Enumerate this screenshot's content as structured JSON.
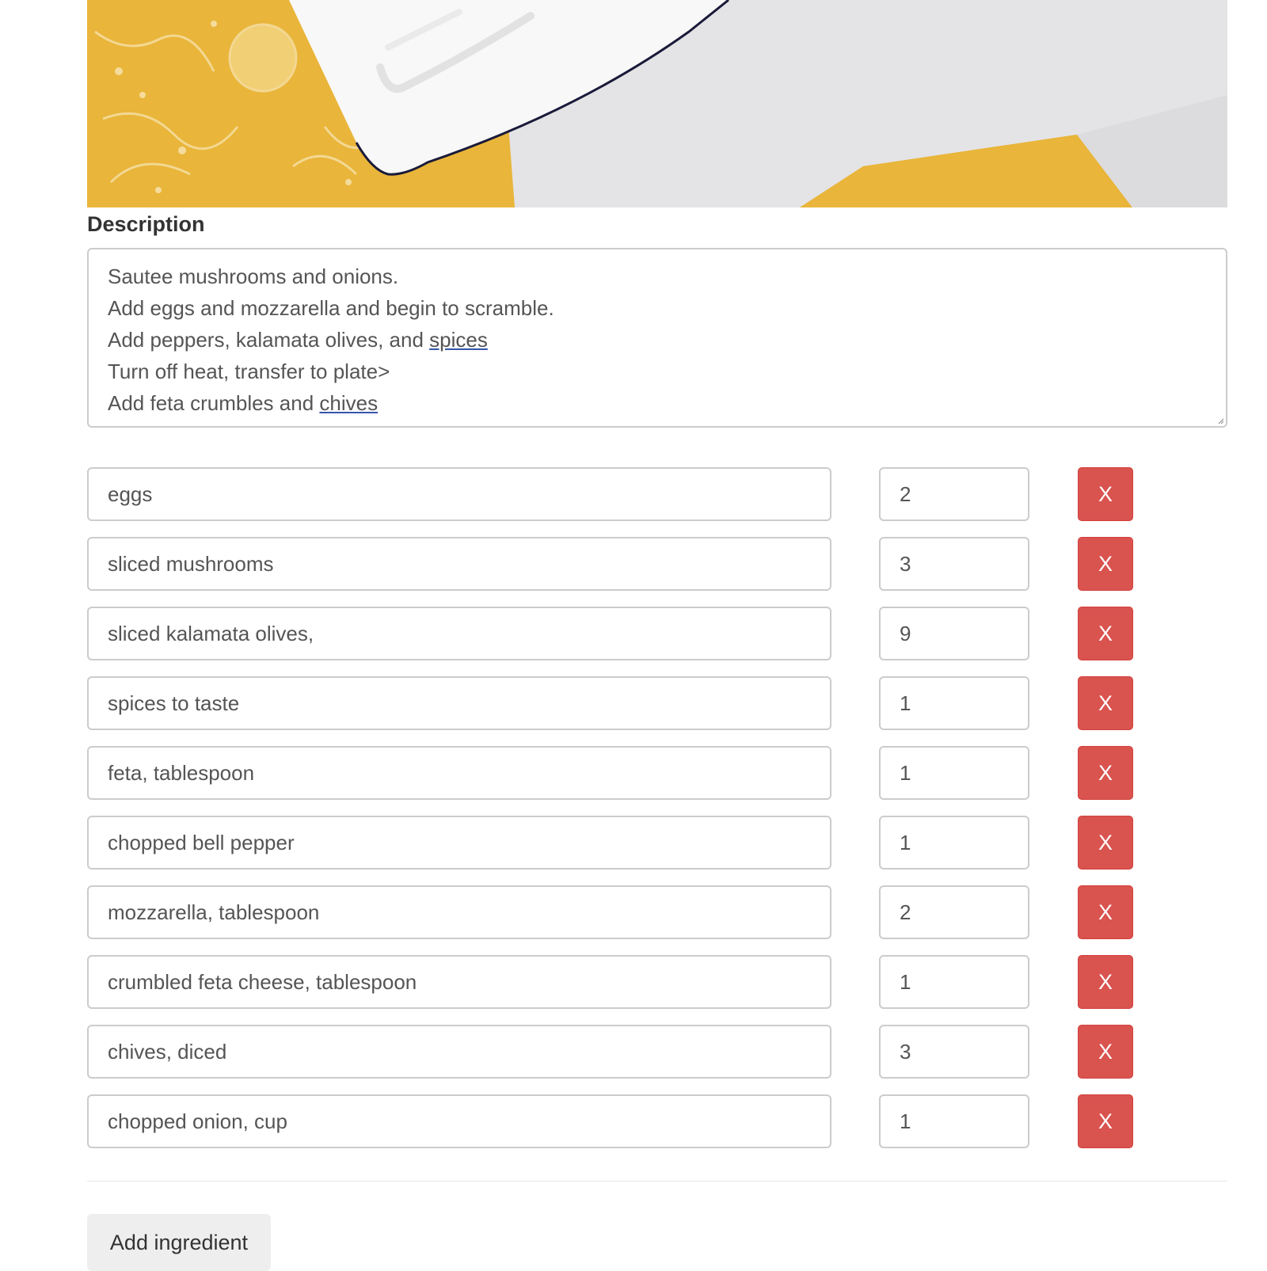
{
  "photo": {
    "alt_icon": "recipe-photo",
    "colors": {
      "cloth": "#e9b53a",
      "plate": "#f7f7f7",
      "napkin": "#e6e6e6"
    }
  },
  "description": {
    "label": "Description",
    "lines": [
      "Sautee mushrooms and onions.",
      "Add eggs and mozzarella and begin to scramble.",
      "Add peppers, kalamata olives, and spices",
      "Turn off heat, transfer to plate>",
      "Add feta crumbles and chives"
    ]
  },
  "ingredients": [
    {
      "name": "eggs",
      "quantity": "2",
      "delete_label": "X"
    },
    {
      "name": "sliced mushrooms",
      "quantity": "3",
      "delete_label": "X"
    },
    {
      "name": "sliced kalamata olives,",
      "quantity": "9",
      "delete_label": "X"
    },
    {
      "name": "spices to taste",
      "quantity": "1",
      "delete_label": "X"
    },
    {
      "name": "feta, tablespoon",
      "quantity": "1",
      "delete_label": "X"
    },
    {
      "name": "chopped bell pepper",
      "quantity": "1",
      "delete_label": "X"
    },
    {
      "name": "mozzarella, tablespoon",
      "quantity": "2",
      "delete_label": "X"
    },
    {
      "name": "crumbled feta cheese, tablespoon",
      "quantity": "1",
      "delete_label": "X"
    },
    {
      "name": "chives, diced",
      "quantity": "3",
      "delete_label": "X"
    },
    {
      "name": "chopped onion, cup",
      "quantity": "1",
      "delete_label": "X"
    }
  ],
  "actions": {
    "add_ingredient_label": "Add ingredient"
  },
  "colors": {
    "danger": "#d9534f",
    "border": "#cccccc",
    "text": "#555555",
    "default_button": "#eeeeee"
  }
}
